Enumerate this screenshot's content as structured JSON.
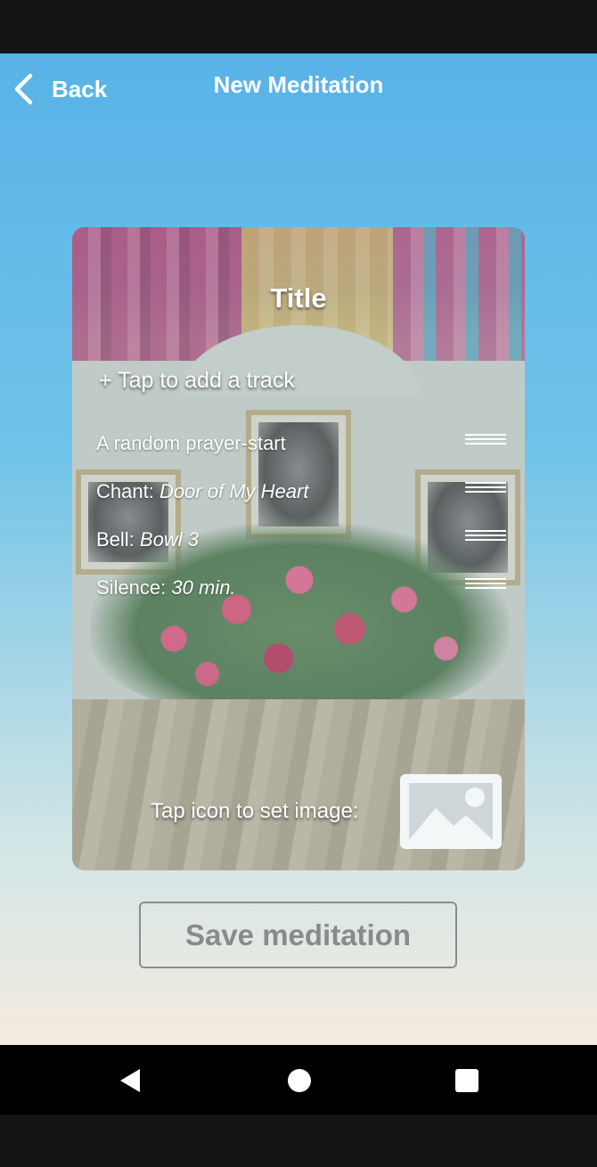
{
  "header": {
    "back_label": "Back",
    "title": "New Meditation"
  },
  "card": {
    "title": "Title",
    "add_track_label": "+ Tap to add a track",
    "tracks": [
      {
        "label": "A random prayer-start",
        "value": ""
      },
      {
        "label": "Chant: ",
        "value": "Door of My Heart"
      },
      {
        "label": "Bell: ",
        "value": "Bowl 3"
      },
      {
        "label": "Silence: ",
        "value": "30 min."
      }
    ],
    "set_image_label": "Tap icon to set image:",
    "image_icon": "image-icon"
  },
  "save_button_label": "Save meditation",
  "colors": {
    "background_top": "#58b2e6",
    "background_bottom": "#f5ebdf",
    "text_primary": "#ffffff",
    "button_disabled": "#8a8a8a"
  },
  "system_nav": {
    "icons": [
      "back-triangle-icon",
      "home-circle-icon",
      "recents-square-icon"
    ]
  }
}
